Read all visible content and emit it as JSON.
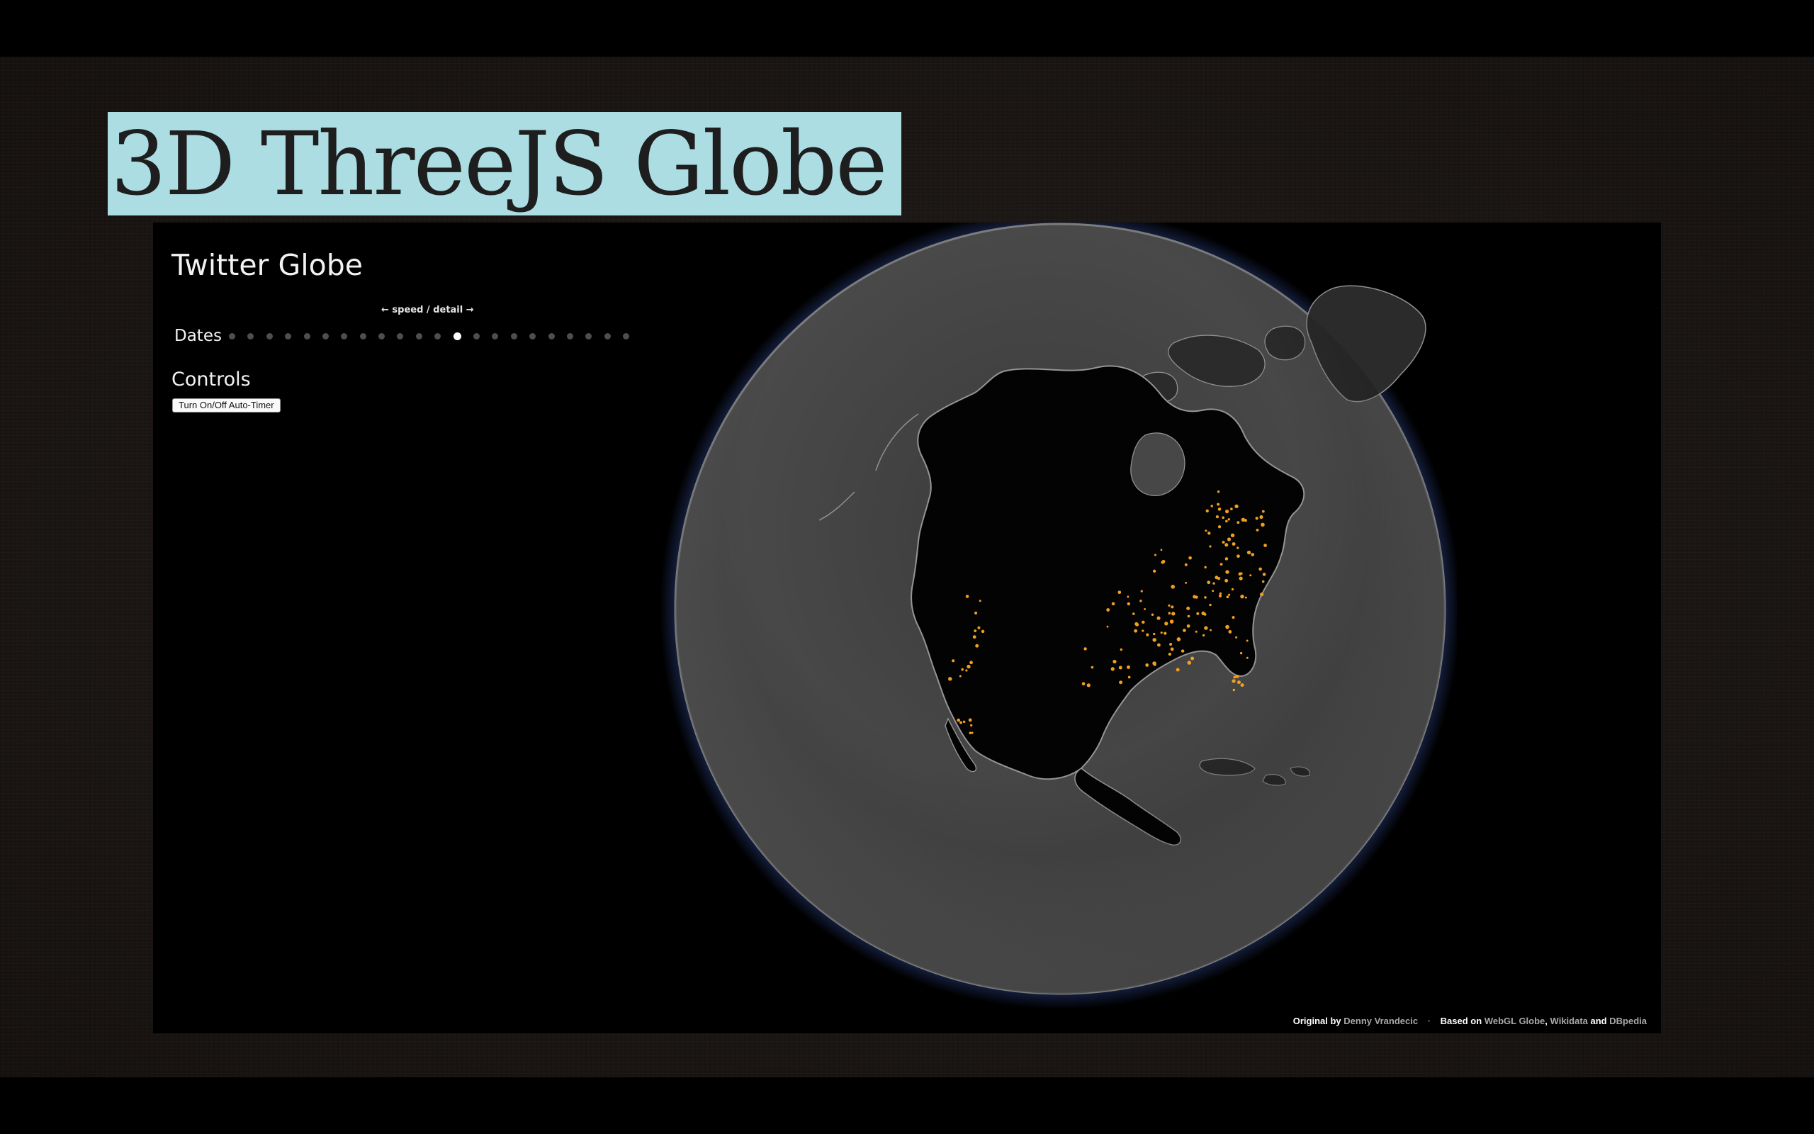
{
  "slide": {
    "title": "3D ThreeJS Globe"
  },
  "app": {
    "title": "Twitter Globe",
    "speed_hint": "← speed / detail →",
    "dates": {
      "label": "Dates",
      "count": 22,
      "active_index": 12
    },
    "controls": {
      "heading": "Controls",
      "auto_timer_label": "Turn On/Off Auto-Timer"
    },
    "credits": {
      "original_by_label": "Original by",
      "author": "Denny Vrandecic",
      "separator": "·",
      "based_on_label": "Based on",
      "webgl_globe": "WebGL Globe",
      "comma": ",",
      "wikidata": "Wikidata",
      "and_label": "and",
      "dbpedia": "DBpedia"
    }
  },
  "colors": {
    "title_box": "#abdde2",
    "tweet_dot": "#f0a020",
    "globe_land": "#2a2a2a",
    "globe_water": "#4a4a4a"
  }
}
